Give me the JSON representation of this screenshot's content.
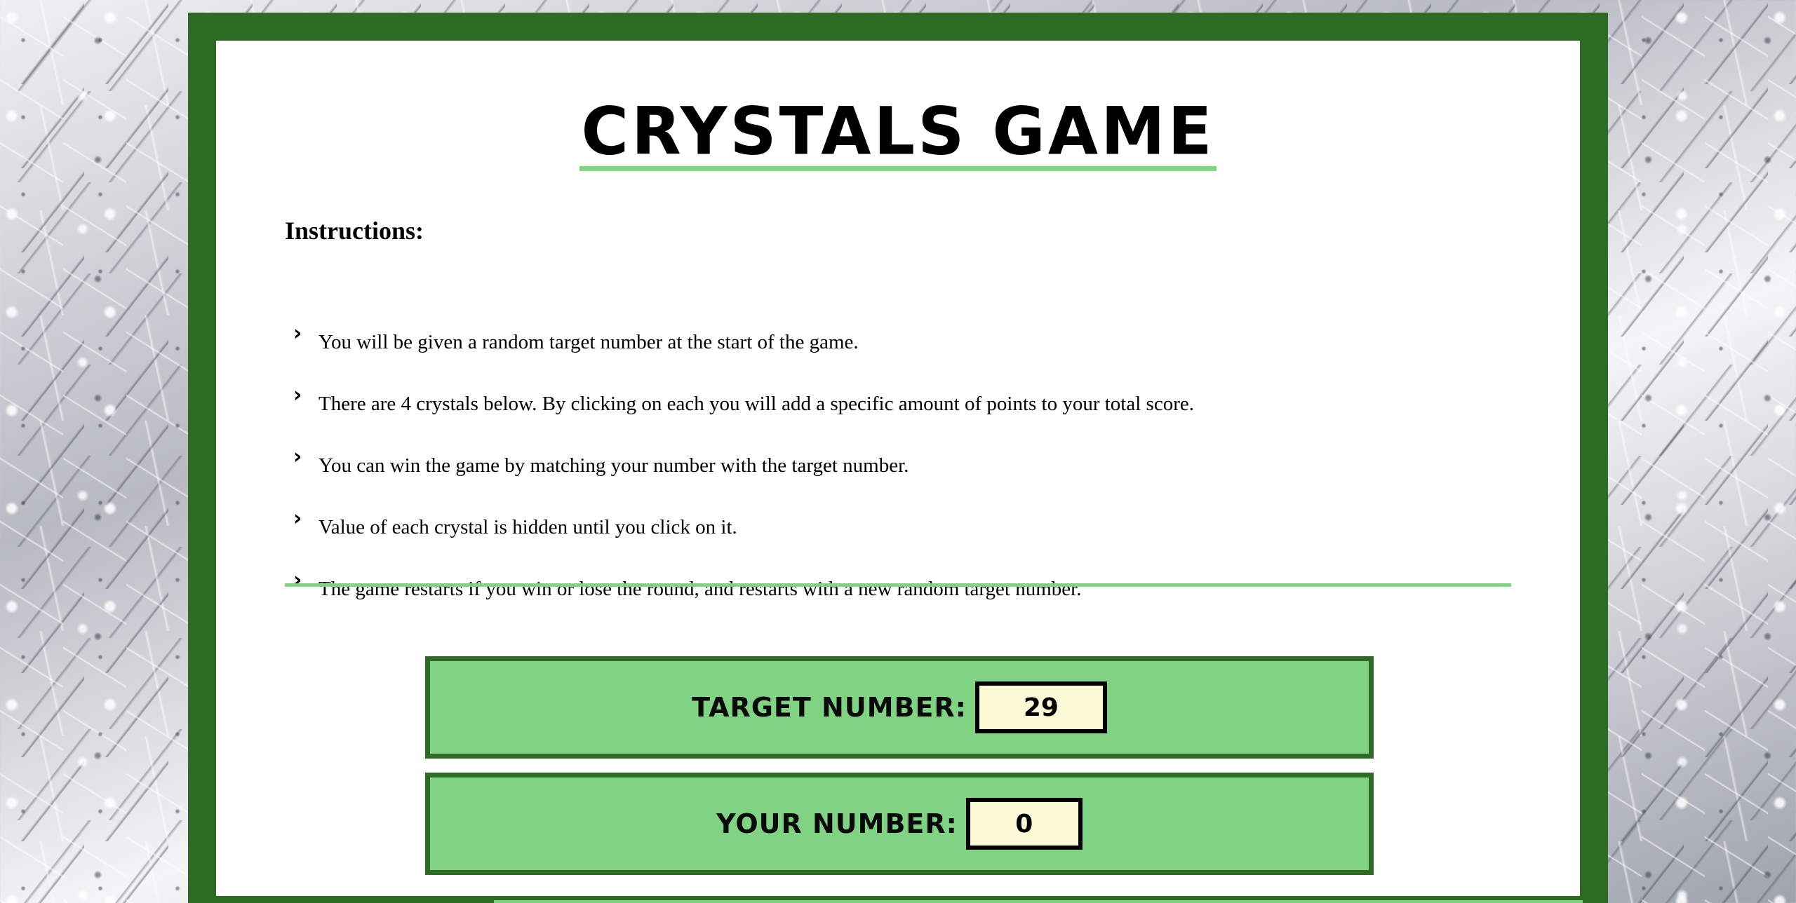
{
  "page": {
    "title": "CRYSTALS GAME"
  },
  "instructions": {
    "heading": "Instructions:",
    "bullet_icon": "chevron-right-icon",
    "items": [
      "You will be given a random target number at the start of the game.",
      "There are 4 crystals below. By clicking on each you will add a specific amount of points to your total score.",
      "You can win the game by matching your number with the target number.",
      "Value of each crystal is hidden until you click on it.",
      "The game restarts if you win or lose the round, and restarts with a new random target number."
    ]
  },
  "scoreboard": {
    "target_label": "TARGET NUMBER:",
    "target_value": "29",
    "your_label": "YOUR NUMBER:",
    "your_value": "0"
  },
  "colors": {
    "frame": "#2e6b24",
    "accent_green": "#80d383",
    "value_box": "#fbf8d6"
  }
}
